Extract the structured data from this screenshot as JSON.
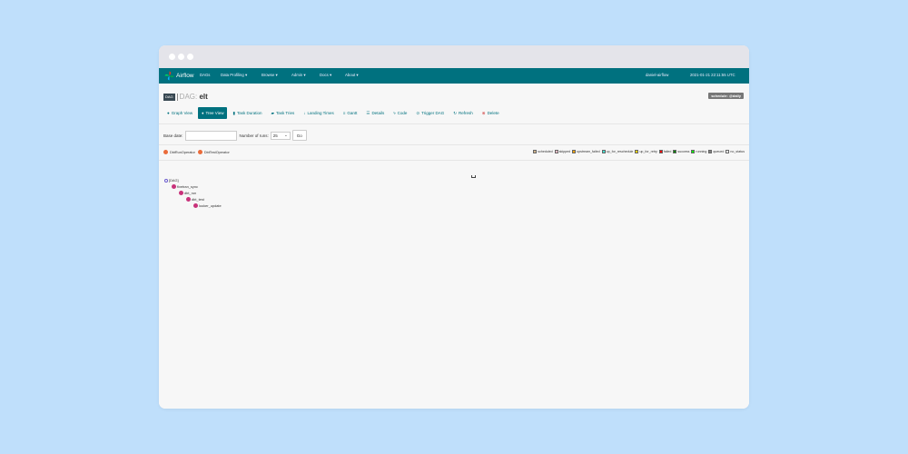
{
  "navbar": {
    "brand": "Airflow",
    "items": [
      "DAGs",
      "Data Profiling ▾",
      "Browse ▾",
      "Admin ▾",
      "Docs ▾",
      "About ▾"
    ],
    "user": "daniel-airflow",
    "datetime": "2021-01-21 22:11:55 UTC"
  },
  "dag": {
    "badge": "DAG",
    "label": "DAG:",
    "name": "elt",
    "schedule": "schedule: @daily"
  },
  "tabs": [
    {
      "label": "Graph View",
      "icon": "graph-icon"
    },
    {
      "label": "Tree View",
      "icon": "tree-icon"
    },
    {
      "label": "Task Duration",
      "icon": "duration-icon"
    },
    {
      "label": "Task Tries",
      "icon": "tries-icon"
    },
    {
      "label": "Landing Times",
      "icon": "landing-icon"
    },
    {
      "label": "Gantt",
      "icon": "gantt-icon"
    },
    {
      "label": "Details",
      "icon": "details-icon"
    },
    {
      "label": "Code",
      "icon": "code-icon"
    },
    {
      "label": "Trigger DAG",
      "icon": "trigger-icon"
    },
    {
      "label": "Refresh",
      "icon": "refresh-icon"
    },
    {
      "label": "Delete",
      "icon": "delete-icon"
    }
  ],
  "form": {
    "base_date_label": "Base date:",
    "base_date_value": "",
    "runs_label": "Number of runs:",
    "runs_value": "25",
    "go_label": "Go"
  },
  "operators": [
    "DbtRunOperator",
    "DbtTestOperator"
  ],
  "legend": [
    {
      "label": "scheduled",
      "color": "#d2b48c"
    },
    {
      "label": "skipped",
      "color": "#ffc0cb"
    },
    {
      "label": "upstream_failed",
      "color": "#ffa500"
    },
    {
      "label": "up_for_reschedule",
      "color": "#40e0d0"
    },
    {
      "label": "up_for_retry",
      "color": "#ffd700"
    },
    {
      "label": "failed",
      "color": "#ff0000"
    },
    {
      "label": "success",
      "color": "#008000"
    },
    {
      "label": "running",
      "color": "#00ff00"
    },
    {
      "label": "queued",
      "color": "#808080"
    },
    {
      "label": "no_status",
      "color": "#ffffff"
    }
  ],
  "tree": {
    "root": "[DAG]",
    "tasks": [
      "fivetran_sync",
      "dbt_run",
      "dbt_test",
      "looker_update"
    ]
  }
}
